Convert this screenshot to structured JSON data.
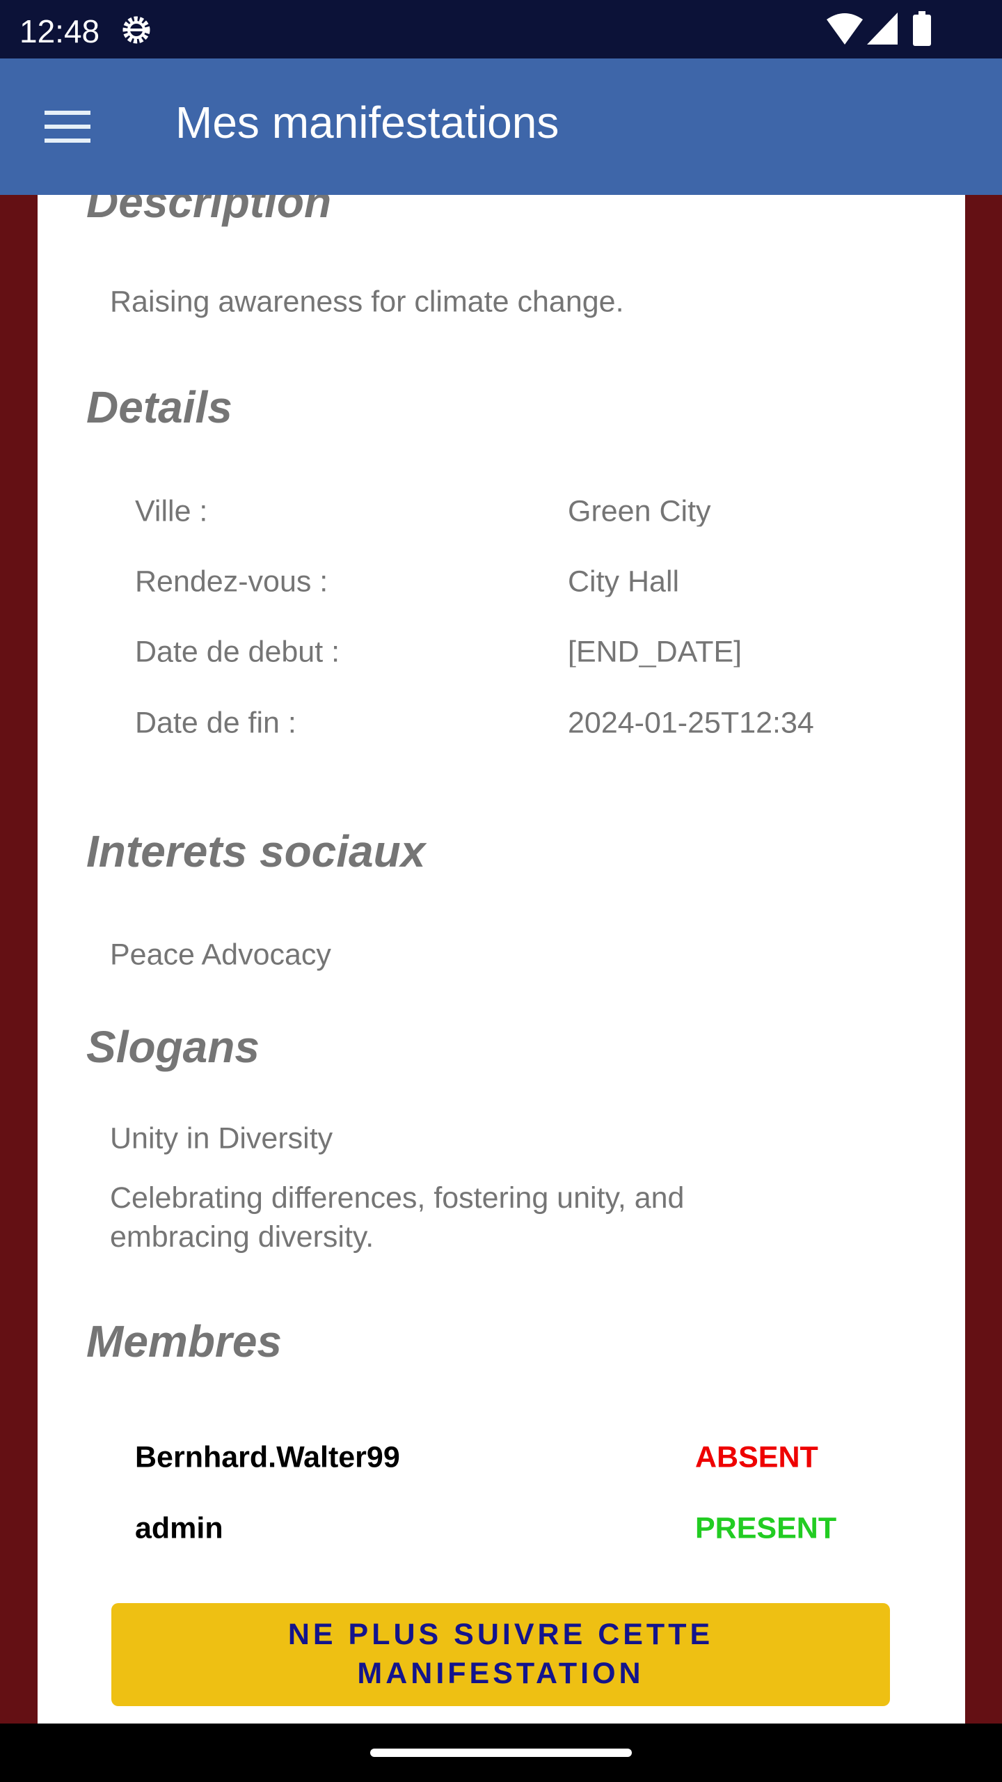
{
  "status_bar": {
    "time": "12:48"
  },
  "app_bar": {
    "title": "Mes manifestations"
  },
  "description": {
    "heading": "Description",
    "text": "Raising awareness for climate change."
  },
  "details": {
    "heading": "Details",
    "rows": [
      {
        "label": "Ville :",
        "value": "Green City"
      },
      {
        "label": "Rendez-vous :",
        "value": "City Hall"
      },
      {
        "label": "Date de debut :",
        "value": "[END_DATE]"
      },
      {
        "label": "Date de fin :",
        "value": "2024-01-25T12:34"
      }
    ]
  },
  "interests": {
    "heading": "Interets sociaux",
    "items": [
      "Peace Advocacy"
    ]
  },
  "slogans": {
    "heading": "Slogans",
    "items": [
      "Unity in Diversity",
      "Celebrating differences, fostering unity, and embracing diversity."
    ]
  },
  "members": {
    "heading": "Membres",
    "items": [
      {
        "name": "Bernhard.Walter99",
        "status": "ABSENT",
        "color": "#ee0000"
      },
      {
        "name": "admin",
        "status": "PRESENT",
        "color": "#22cc22"
      }
    ]
  },
  "action": {
    "unfollow_label": "NE PLUS SUIVRE CETTE MANIFESTATION"
  }
}
